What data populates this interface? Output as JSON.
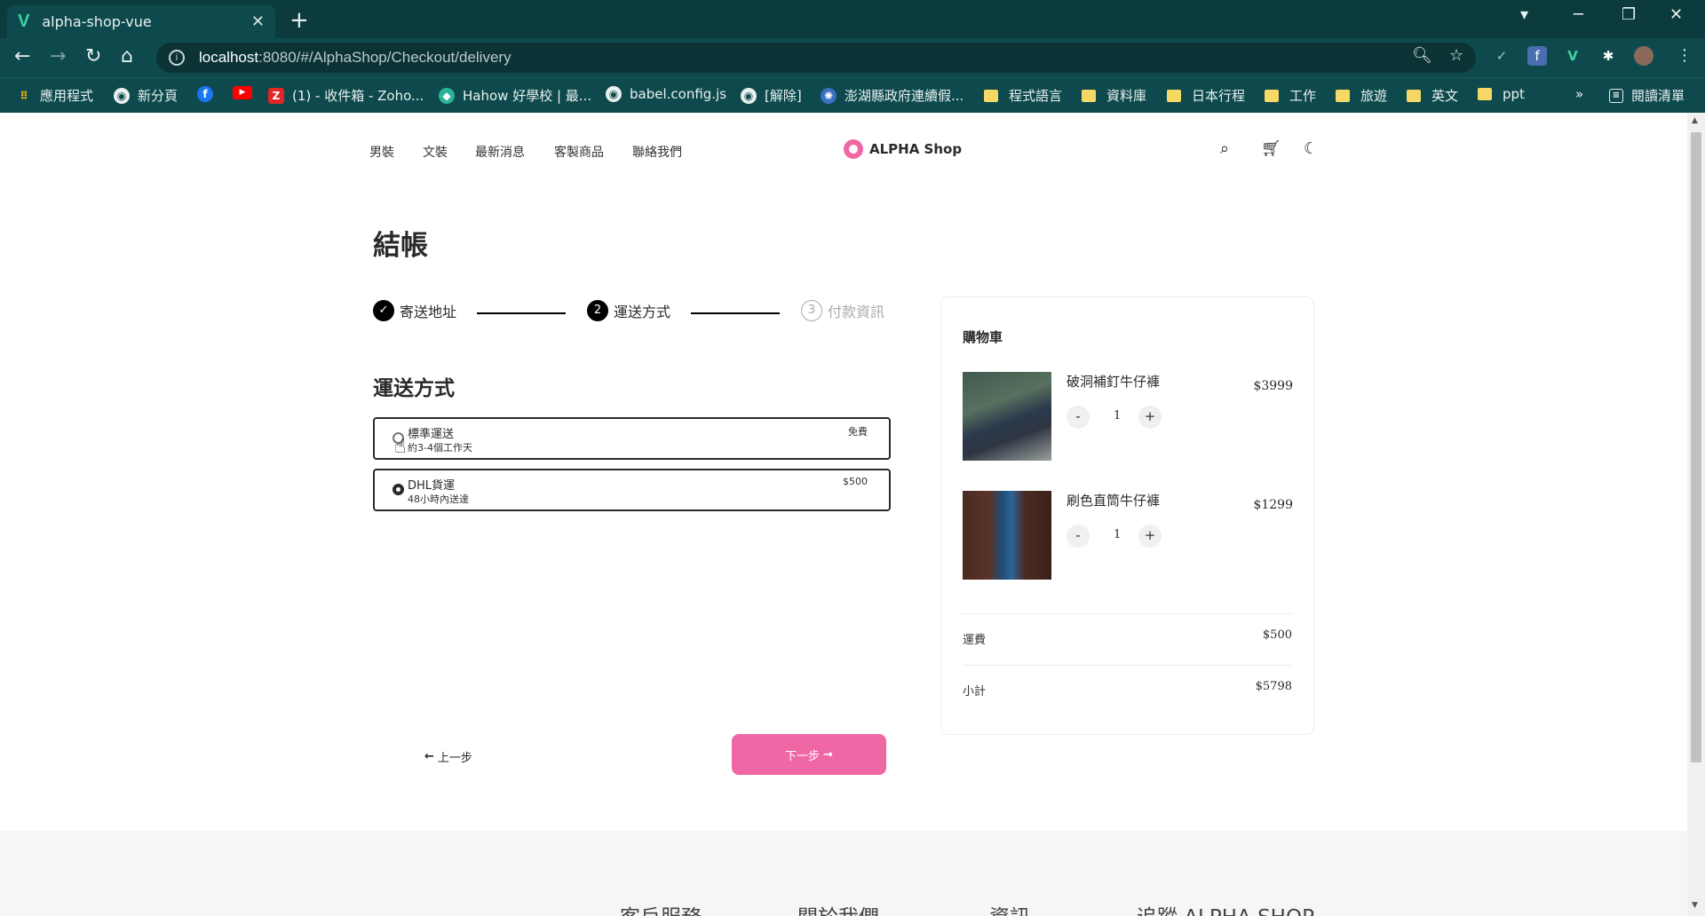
{
  "browser": {
    "tab_title": "alpha-shop-vue",
    "tab_icon": "V",
    "new_tab": "+",
    "url_host": "localhost",
    "url_path": ":8080/#/AlphaShop/Checkout/delivery",
    "bookmarks": [
      {
        "label": "應用程式",
        "icon": "apps-grid-icon"
      },
      {
        "label": "新分頁",
        "icon": "globe-icon"
      },
      {
        "label": "",
        "icon": "facebook-icon"
      },
      {
        "label": "",
        "icon": "youtube-icon"
      },
      {
        "label": "(1) - 收件箱 - Zoho...",
        "icon": "zoho-icon"
      },
      {
        "label": "Hahow 好學校 | 最...",
        "icon": "hahow-icon"
      },
      {
        "label": "babel.config.js",
        "icon": "globe-icon"
      },
      {
        "label": "[解除]",
        "icon": "globe-icon"
      },
      {
        "label": "澎湖縣政府連續假...",
        "icon": "gov-icon"
      },
      {
        "label": "程式語言",
        "icon": "folder-icon"
      },
      {
        "label": "資料庫",
        "icon": "folder-icon"
      },
      {
        "label": "日本行程",
        "icon": "folder-icon"
      },
      {
        "label": "工作",
        "icon": "folder-icon"
      },
      {
        "label": "旅遊",
        "icon": "folder-icon"
      },
      {
        "label": "英文",
        "icon": "folder-icon"
      },
      {
        "label": "ppt",
        "icon": "folder-icon"
      }
    ],
    "more": "»",
    "reading_list": "閱讀清單"
  },
  "site": {
    "nav": [
      "男裝",
      "文裝",
      "最新消息",
      "客製商品",
      "聯絡我們"
    ],
    "brand": "ALPHA Shop"
  },
  "checkout": {
    "title": "結帳",
    "steps": [
      {
        "num": "✓",
        "label": "寄送地址"
      },
      {
        "num": "2",
        "label": "運送方式"
      },
      {
        "num": "3",
        "label": "付款資訊"
      }
    ],
    "section_title": "運送方式",
    "shipping": [
      {
        "name": "標準運送",
        "desc": "約3-4個工作天",
        "price": "免費",
        "selected": false
      },
      {
        "name": "DHL貨運",
        "desc": "48小時內送達",
        "price": "$500",
        "selected": true
      }
    ],
    "prev_label": "上一步",
    "next_label": "下一步"
  },
  "cart": {
    "title": "購物車",
    "items": [
      {
        "name": "破洞補釘牛仔褲",
        "price": "$3999",
        "qty": "1"
      },
      {
        "name": "刷色直筒牛仔褲",
        "price": "$1299",
        "qty": "1"
      }
    ],
    "shipping_label": "運費",
    "shipping_value": "$500",
    "subtotal_label": "小計",
    "subtotal_value": "$5798"
  },
  "footer": [
    "客戶服務",
    "關於我們",
    "資訊",
    "追蹤 ALPHA SHOP"
  ],
  "colors": {
    "accent": "#f067a6",
    "chrome": "#0e4a4d"
  }
}
